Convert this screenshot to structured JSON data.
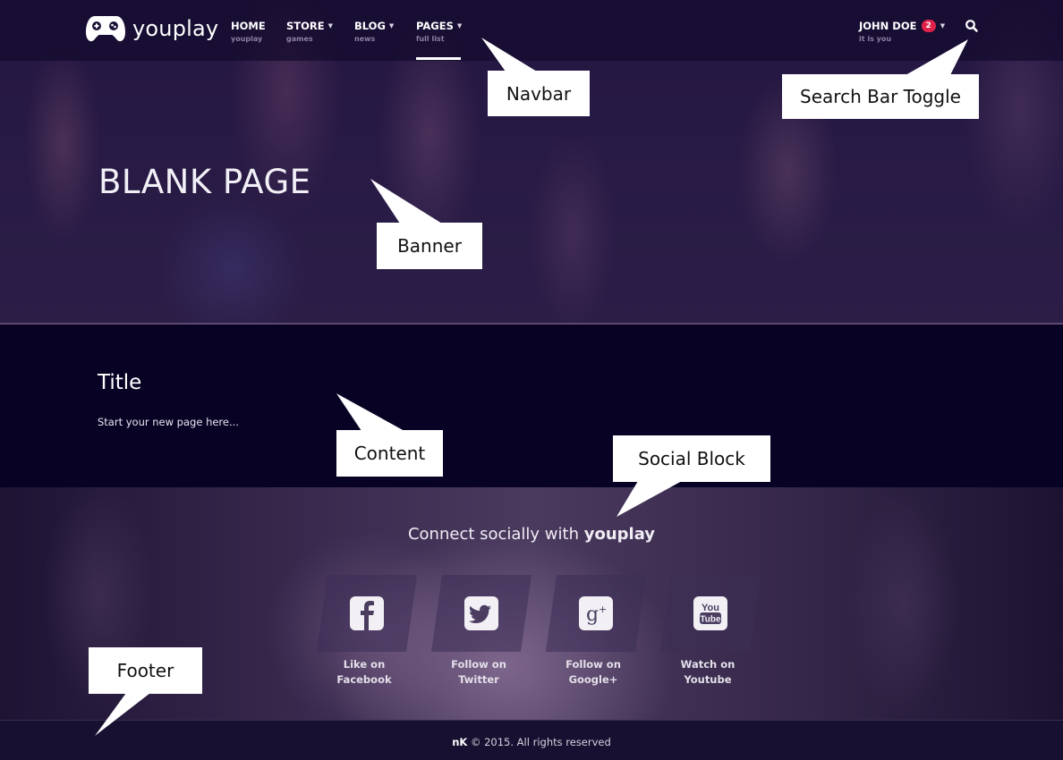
{
  "brand": {
    "name": "youplay",
    "logo_icon": "gamepad-icon"
  },
  "navbar": {
    "items": [
      {
        "label": "HOME",
        "sub": "youplay",
        "has_dropdown": false,
        "active": false
      },
      {
        "label": "STORE",
        "sub": "games",
        "has_dropdown": true,
        "active": false
      },
      {
        "label": "BLOG",
        "sub": "news",
        "has_dropdown": true,
        "active": false
      },
      {
        "label": "PAGES",
        "sub": "full list",
        "has_dropdown": true,
        "active": true
      }
    ],
    "user": {
      "name": "JOHN DOE",
      "sub": "it is you",
      "notifications": "2",
      "has_dropdown": true
    },
    "search_icon": "search-icon"
  },
  "banner": {
    "title": "BLANK PAGE"
  },
  "content": {
    "title": "Title",
    "text": "Start your new page here..."
  },
  "social": {
    "heading_prefix": "Connect socially with ",
    "heading_brand": "youplay",
    "items": [
      {
        "icon": "facebook-icon",
        "line1": "Like on",
        "line2": "Facebook"
      },
      {
        "icon": "twitter-icon",
        "line1": "Follow on",
        "line2": "Twitter"
      },
      {
        "icon": "google-plus-icon",
        "line1": "Follow on",
        "line2": "Google+"
      },
      {
        "icon": "youtube-icon",
        "line1": "Watch on",
        "line2": "Youtube"
      }
    ]
  },
  "footer": {
    "copyright_brand": "nK",
    "copyright_text": " © 2015. All rights reserved"
  },
  "annotations": {
    "navbar": "Navbar",
    "search": "Search Bar Toggle",
    "banner": "Banner",
    "content": "Content",
    "social": "Social Block",
    "footer": "Footer"
  },
  "colors": {
    "accent_badge": "#e0224b",
    "content_bg": "#080325",
    "active_underline": "#ffffff"
  }
}
